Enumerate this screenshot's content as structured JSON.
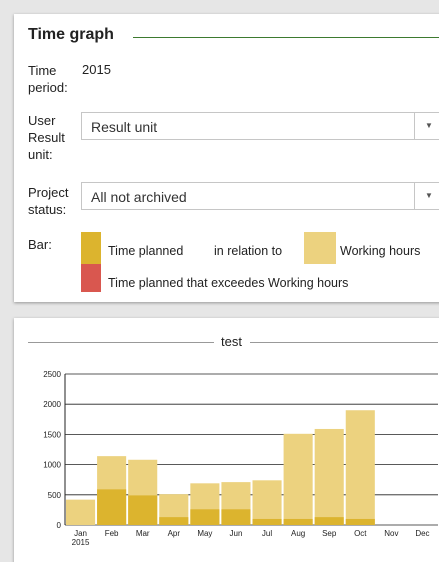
{
  "settings": {
    "title": "Time graph",
    "time_period_label": [
      "Time",
      "period:"
    ],
    "time_period_value": "2015",
    "user_result_unit_label": [
      "User",
      "Result",
      "unit:"
    ],
    "user_result_unit_value": "Result unit",
    "project_status_label": [
      "Project",
      "status:"
    ],
    "project_status_value": "All not archived",
    "bar_label": "Bar:",
    "legend": {
      "planned": "Time planned",
      "in_relation_to": "in relation to",
      "working_hours": "Working hours",
      "exceeds": "Time planned that exceedes Working hours"
    },
    "dropdown_icon": "caret-down-icon"
  },
  "colors": {
    "planned": "#dcb42e",
    "working_hours": "#ecd27f",
    "exceeds": "#d9574f",
    "title_rule": "#3d7a2f"
  },
  "chart_data": {
    "type": "bar",
    "title": "test",
    "categories": [
      "Jan",
      "Feb",
      "Mar",
      "Apr",
      "May",
      "Jun",
      "Jul",
      "Aug",
      "Sep",
      "Oct",
      "Nov",
      "Dec"
    ],
    "x_sublabel": "2015",
    "series": [
      {
        "name": "Working hours",
        "values": [
          420,
          1140,
          1080,
          510,
          690,
          710,
          740,
          1510,
          1590,
          1900,
          0,
          0
        ]
      },
      {
        "name": "Time planned",
        "values": [
          0,
          590,
          490,
          130,
          260,
          260,
          100,
          100,
          130,
          100,
          0,
          0
        ]
      }
    ],
    "yticks": [
      0,
      500,
      1000,
      1500,
      2000,
      2500
    ],
    "ylim": [
      0,
      2500
    ],
    "grid": true
  }
}
